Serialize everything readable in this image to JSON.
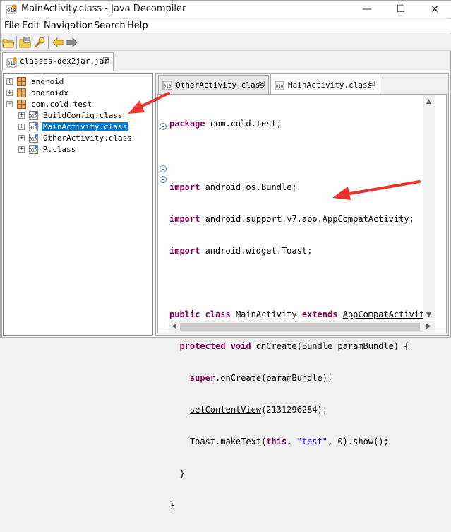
{
  "window": {
    "title": "MainActivity.class - Java Decompiler",
    "minimize": "—",
    "maximize": "☐",
    "close": "✕"
  },
  "menu": [
    "File",
    "Edit",
    "Navigation",
    "Search",
    "Help"
  ],
  "jar_tab": {
    "label": "classes-dex2jar.jar",
    "close": "☒"
  },
  "tree": [
    {
      "label": "android",
      "expander": "+",
      "icon": "package-icon"
    },
    {
      "label": "androidx",
      "expander": "+",
      "icon": "package-icon"
    },
    {
      "label": "com.cold.test",
      "expander": "−",
      "icon": "package-icon"
    },
    {
      "label": "BuildConfig.class",
      "expander": "+",
      "icon": "class-file-icon"
    },
    {
      "label": "MainActivity.class",
      "expander": "+",
      "icon": "class-file-icon",
      "selected": true
    },
    {
      "label": "OtherActivity.class",
      "expander": "+",
      "icon": "class-file-icon"
    },
    {
      "label": "R.class",
      "expander": "+",
      "icon": "class-file-icon"
    }
  ],
  "editor_tabs": [
    {
      "label": "OtherActivity.class",
      "close": "☒",
      "active": false
    },
    {
      "label": "MainActivity.class",
      "close": "☒",
      "active": true
    }
  ],
  "code": {
    "package_kw": "package",
    "package_name": " com.cold.test;",
    "import_kw": "import",
    "import1": " android.os.Bundle;",
    "import2": "android.support.v7.app.AppCompatActivity",
    "import2_end": ";",
    "import3": " android.widget.Toast;",
    "class_public": "public",
    "class_kw": "class",
    "class_name": " MainActivity ",
    "extends_kw": "extends",
    "super_class": "AppCompatActivity",
    "method_mods": "protected void",
    "method_sig": " onCreate(Bundle paramBundle) {",
    "super_kw": "super",
    "super_call": "onCreate",
    "super_args": "(paramBundle);",
    "set_content": "setContentView",
    "set_content_args": "(2131296284);",
    "toast_start": "Toast.makeText(",
    "this_kw": "this",
    "toast_mid": ", ",
    "toast_str": "\"test\"",
    "toast_end": ", 0).show();",
    "close_method": "}",
    "close_class": "}"
  },
  "colors": {
    "keyword": "#7f0055",
    "string": "#2a00ff",
    "selection": "#0078d7",
    "annotation_arrow": "#e8322a"
  }
}
